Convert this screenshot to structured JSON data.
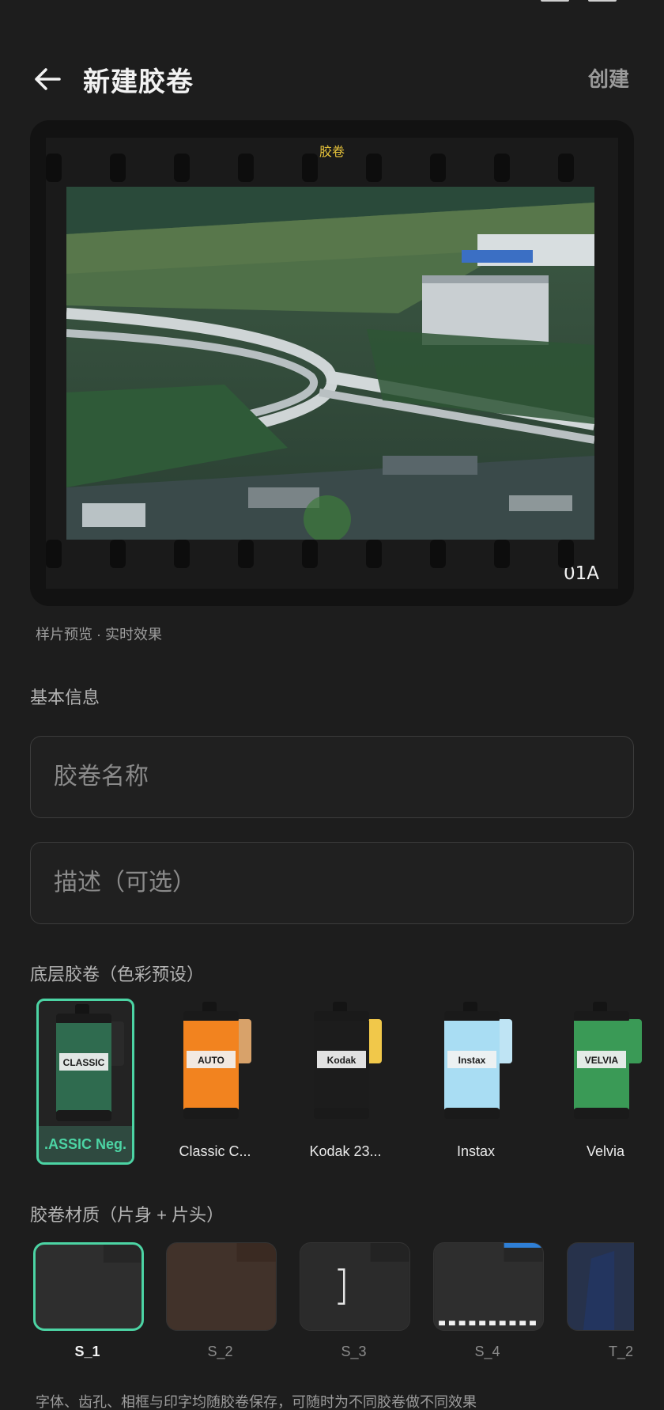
{
  "header": {
    "title": "新建胶卷",
    "create_label": "创建",
    "back_icon": "arrow-left-icon"
  },
  "preview": {
    "film_label": "胶卷",
    "frame_number": "01A",
    "caption": "样片预览 · 实时效果"
  },
  "basic_info": {
    "section_title": "基本信息",
    "name_placeholder": "胶卷名称",
    "name_value": "",
    "description_placeholder": "描述（可选）",
    "description_value": ""
  },
  "base_film": {
    "section_title": "底层胶卷（色彩预设）",
    "selected_index": 0,
    "items": [
      {
        "label": ".ASSIC Neg.",
        "body_color": "#2f6b4f",
        "tab_color": "#2a2a2a",
        "can_text": "CLASSIC"
      },
      {
        "label": "Classic C...",
        "body_color": "#f2831f",
        "tab_color": "#d8a26a",
        "can_text": "AUTO"
      },
      {
        "label": "Kodak 23...",
        "body_color": "#1c1c1c",
        "tab_color": "#f1c84a",
        "can_text": "Kodak"
      },
      {
        "label": "Instax",
        "body_color": "#a9ddf3",
        "tab_color": "#bfe4f4",
        "can_text": "Instax"
      },
      {
        "label": "Velvia",
        "body_color": "#3a9a56",
        "tab_color": "#3a9a56",
        "can_text": "VELVIA"
      }
    ]
  },
  "material": {
    "section_title": "胶卷材质（片身 + 片头）",
    "selected_index": 0,
    "items": [
      {
        "label": "S_1",
        "color": "#262626"
      },
      {
        "label": "S_2",
        "color": "#3a2a22"
      },
      {
        "label": "S_3",
        "color": "#232323"
      },
      {
        "label": "S_4",
        "color": "#262626"
      },
      {
        "label": "T_2",
        "color": "#1f2a44"
      }
    ]
  },
  "footer_note": "字体、齿孔、相框与印字均随胶卷保存，可随时为不同胶卷做不同效果"
}
